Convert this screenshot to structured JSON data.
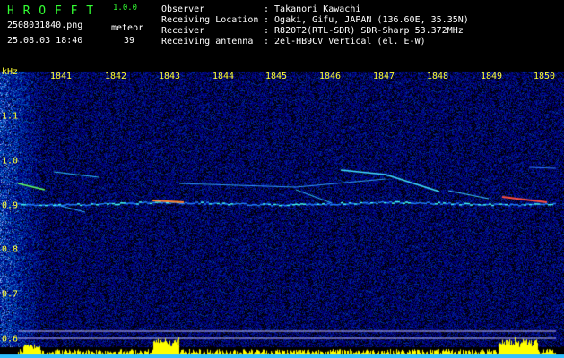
{
  "app": {
    "name": "H R O F F T",
    "version": "1.0.0",
    "filename": "2508031840.png",
    "datetime": "25.08.03 18:40",
    "meteor_label": "meteor",
    "meteor_count": "39"
  },
  "info": {
    "rows": [
      {
        "label": "Observer",
        "value": ": Takanori Kawachi"
      },
      {
        "label": "Receiving Location",
        "value": ": Ogaki, Gifu, JAPAN (136.60E, 35.35N)"
      },
      {
        "label": "Receiver",
        "value": ": R820T2(RTL-SDR) SDR-Sharp 53.372MHz"
      },
      {
        "label": "Receiving antenna",
        "value": ": 2el-HB9CV Vertical (el. E-W)"
      }
    ]
  },
  "axes": {
    "y_unit": "kHz",
    "x_ticks": [
      "1841",
      "1842",
      "1843",
      "1844",
      "1845",
      "1846",
      "1847",
      "1848",
      "1849",
      "1850"
    ],
    "y_ticks": [
      "1.1",
      "1.0",
      "0.9",
      "0.8",
      "0.7",
      "0.6"
    ]
  },
  "colors": {
    "background": "#000000",
    "noise": "#0a1ea0",
    "trace": "#30d0ff",
    "hot": "#ff3030",
    "axis_text": "#ffff33",
    "header_green": "#33ff33",
    "power_bar": "#ffff00"
  }
}
